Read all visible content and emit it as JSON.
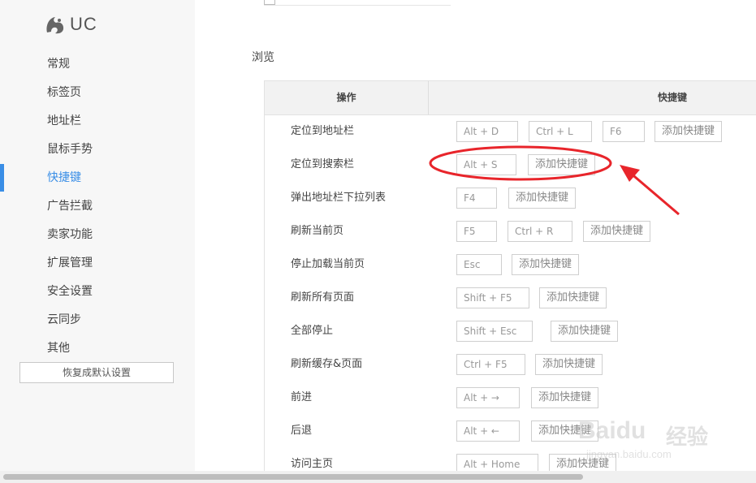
{
  "brand": {
    "logo_text": "UC",
    "accent": "#3a8ee6"
  },
  "sidebar": {
    "items": [
      "常规",
      "标签页",
      "地址栏",
      "鼠标手势",
      "快捷键",
      "广告拦截",
      "卖家功能",
      "扩展管理",
      "安全设置",
      "云同步",
      "其他"
    ],
    "active_index": 4,
    "reset_label": "恢复成默认设置"
  },
  "section": {
    "title": "浏览"
  },
  "table": {
    "col_action": "操作",
    "col_shortcut": "快捷键",
    "add_label": "添加快捷键",
    "rows": [
      {
        "action": "定位到地址栏",
        "keys": [
          "Alt + D",
          "Ctrl + L",
          "F6"
        ]
      },
      {
        "action": "定位到搜索栏",
        "keys": [
          "Alt + S"
        ]
      },
      {
        "action": "弹出地址栏下拉列表",
        "keys": [
          "F4"
        ]
      },
      {
        "action": "刷新当前页",
        "keys": [
          "F5",
          "Ctrl + R"
        ]
      },
      {
        "action": "停止加载当前页",
        "keys": [
          "Esc"
        ]
      },
      {
        "action": "刷新所有页面",
        "keys": [
          "Shift + F5"
        ]
      },
      {
        "action": "全部停止",
        "keys": [
          "Shift + Esc"
        ]
      },
      {
        "action": "刷新缓存&页面",
        "keys": [
          "Ctrl + F5"
        ]
      },
      {
        "action": "前进",
        "keys": [
          "Alt + →"
        ]
      },
      {
        "action": "后退",
        "keys": [
          "Alt + ←"
        ]
      },
      {
        "action": "访问主页",
        "keys": [
          "Alt + Home"
        ]
      }
    ]
  },
  "annotation": {
    "color": "#e8252b"
  },
  "watermark": {
    "brand": "Baidu",
    "suffix": "经验",
    "url": "jingyan.baidu.com"
  }
}
